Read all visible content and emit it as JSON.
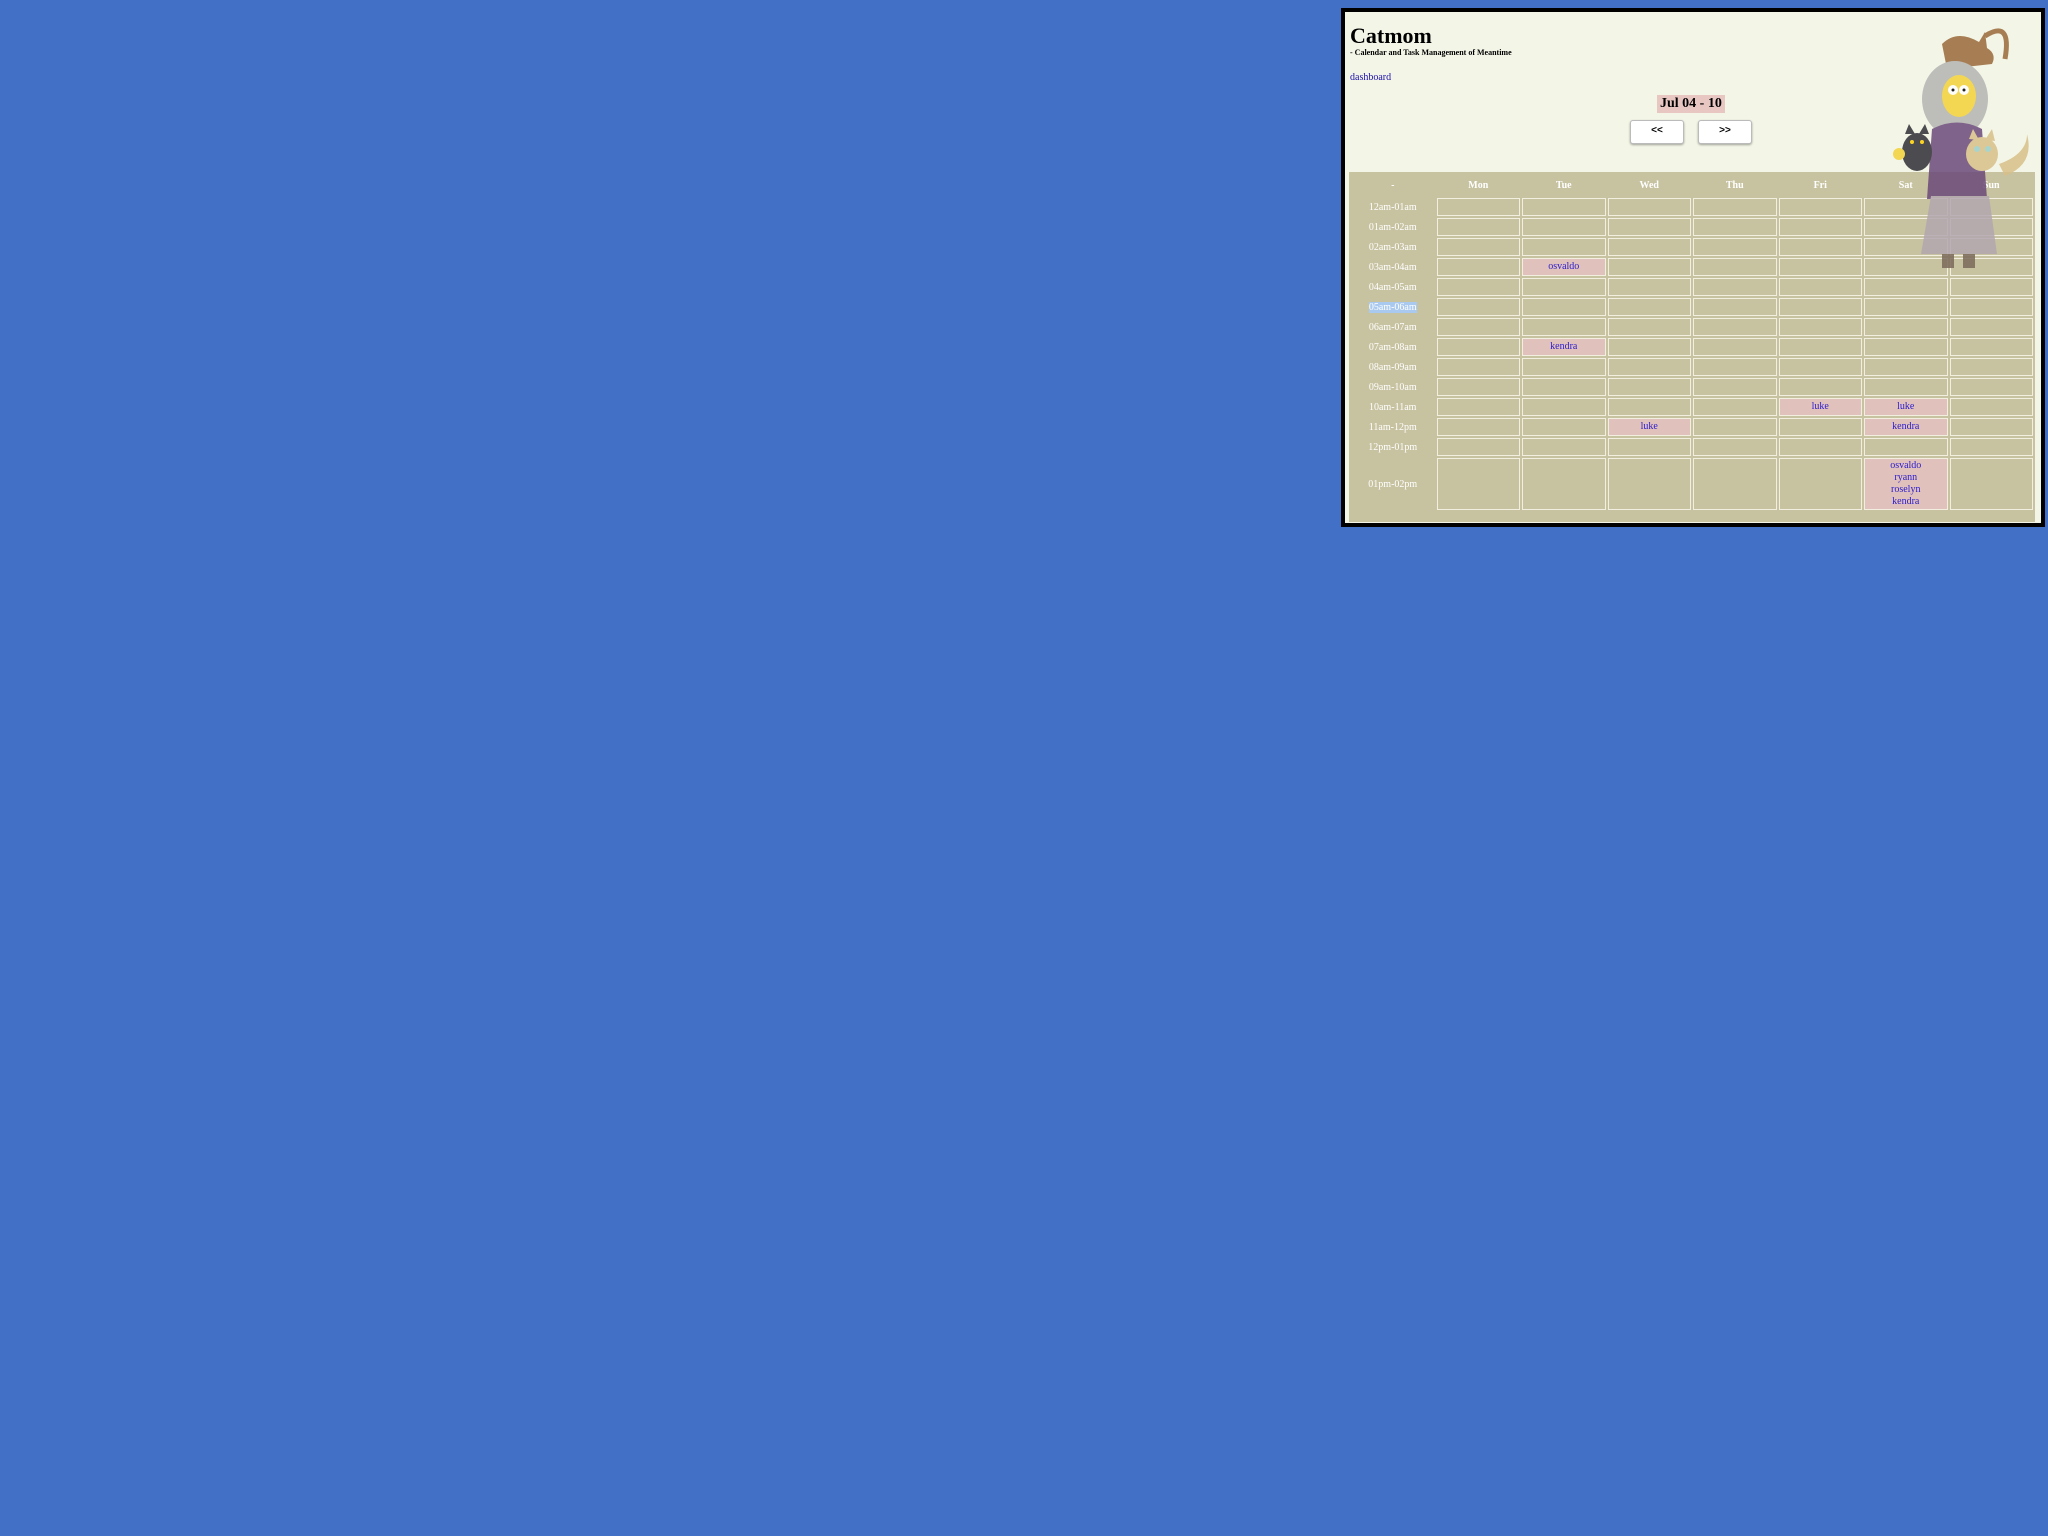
{
  "app": {
    "title": "Catmom",
    "subtitle": "- Calendar and Task Management of Meantime",
    "nav_link": "dashboard"
  },
  "week": {
    "label": "Jul 04 - 10",
    "prev_label": "<<",
    "next_label": ">>"
  },
  "calendar": {
    "corner": "-",
    "days": [
      "Mon",
      "Tue",
      "Wed",
      "Thu",
      "Fri",
      "Sat",
      "Sun"
    ],
    "rows": [
      {
        "time": "12am-01am",
        "cells": [
          [],
          [],
          [],
          [],
          [],
          [],
          []
        ]
      },
      {
        "time": "01am-02am",
        "cells": [
          [],
          [],
          [],
          [],
          [],
          [],
          []
        ]
      },
      {
        "time": "02am-03am",
        "cells": [
          [],
          [],
          [],
          [],
          [],
          [],
          []
        ]
      },
      {
        "time": "03am-04am",
        "cells": [
          [],
          [
            "osvaldo"
          ],
          [],
          [],
          [],
          [],
          []
        ]
      },
      {
        "time": "04am-05am",
        "cells": [
          [],
          [],
          [],
          [],
          [],
          [],
          []
        ]
      },
      {
        "time": "05am-06am",
        "highlight": true,
        "cells": [
          [],
          [],
          [],
          [],
          [],
          [],
          []
        ]
      },
      {
        "time": "06am-07am",
        "cells": [
          [],
          [],
          [],
          [],
          [],
          [],
          []
        ]
      },
      {
        "time": "07am-08am",
        "cells": [
          [],
          [
            "kendra"
          ],
          [],
          [],
          [],
          [],
          []
        ]
      },
      {
        "time": "08am-09am",
        "cells": [
          [],
          [],
          [],
          [],
          [],
          [],
          []
        ]
      },
      {
        "time": "09am-10am",
        "cells": [
          [],
          [],
          [],
          [],
          [],
          [],
          []
        ]
      },
      {
        "time": "10am-11am",
        "cells": [
          [],
          [],
          [],
          [],
          [
            "luke"
          ],
          [
            "luke"
          ],
          []
        ]
      },
      {
        "time": "11am-12pm",
        "cells": [
          [],
          [],
          [
            "luke"
          ],
          [],
          [],
          [
            "kendra"
          ],
          []
        ]
      },
      {
        "time": "12pm-01pm",
        "cells": [
          [],
          [],
          [],
          [],
          [],
          [],
          []
        ]
      },
      {
        "time": "01pm-02pm",
        "cells": [
          [],
          [],
          [],
          [],
          [],
          [
            "osvaldo",
            "ryann",
            "roselyn",
            "kendra"
          ],
          []
        ]
      }
    ]
  },
  "colors": {
    "desktop": "#4170c6",
    "page_bg": "#f3f6e7",
    "calendar_bg": "#c7c2a0",
    "event_bg": "#e1c1bb",
    "event_text": "#2b1ccc",
    "highlight": "#a9c9ef"
  }
}
